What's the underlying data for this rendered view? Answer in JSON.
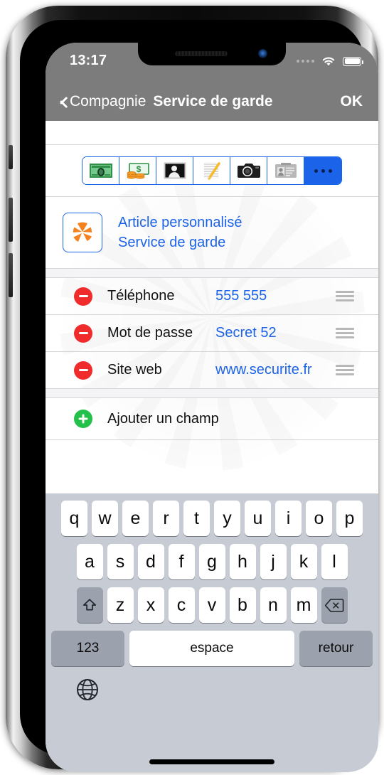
{
  "status_bar": {
    "time": "13:17",
    "signal_icon": "signal-dots-icon",
    "wifi_icon": "wifi-icon",
    "battery_icon": "battery-icon"
  },
  "nav_bar": {
    "back_icon": "chevron-left-icon",
    "back_label": "Compagnie",
    "title": "Service de garde",
    "done_label": "OK"
  },
  "icon_toolbar": {
    "segments": [
      {
        "name": "banknote-icon",
        "selected": false
      },
      {
        "name": "money-coins-icon",
        "selected": false
      },
      {
        "name": "portrait-photo-icon",
        "selected": false
      },
      {
        "name": "notepad-pencil-icon",
        "selected": false
      },
      {
        "name": "camera-icon",
        "selected": false
      },
      {
        "name": "id-card-icon",
        "selected": false
      },
      {
        "name": "more-dots-icon",
        "selected": true,
        "label": "..."
      }
    ]
  },
  "custom_item": {
    "icon": "orange-pinwheel-icon",
    "type_label": "Article personnalisé",
    "name_label": "Service de garde"
  },
  "fields": [
    {
      "delete_icon": "minus-circle-icon",
      "label": "Téléphone",
      "value": "555 555",
      "reorder_icon": "reorder-handle-icon"
    },
    {
      "delete_icon": "minus-circle-icon",
      "label": "Mot de passe",
      "value": "Secret 52",
      "reorder_icon": "reorder-handle-icon"
    },
    {
      "delete_icon": "minus-circle-icon",
      "label": "Site web",
      "value": "www.securite.fr",
      "reorder_icon": "reorder-handle-icon"
    }
  ],
  "add_field": {
    "icon": "plus-circle-icon",
    "label": "Ajouter un champ"
  },
  "keyboard": {
    "row1": [
      "q",
      "w",
      "e",
      "r",
      "t",
      "y",
      "u",
      "i",
      "o",
      "p"
    ],
    "row2": [
      "a",
      "s",
      "d",
      "f",
      "g",
      "h",
      "j",
      "k",
      "l"
    ],
    "row3": [
      "z",
      "x",
      "c",
      "v",
      "b",
      "n",
      "m"
    ],
    "shift_icon": "shift-up-arrow-icon",
    "backspace_icon": "backspace-delete-icon",
    "numbers_label": "123",
    "space_label": "espace",
    "return_label": "retour",
    "globe_icon": "globe-language-icon"
  },
  "colors": {
    "accent_blue": "#1b63e8",
    "nav_gray": "#7c7c7c",
    "delete_red": "#ef2b2b",
    "add_green": "#23c04a",
    "keyboard_bg": "#c7cbd4",
    "icon_orange": "#f58220"
  }
}
